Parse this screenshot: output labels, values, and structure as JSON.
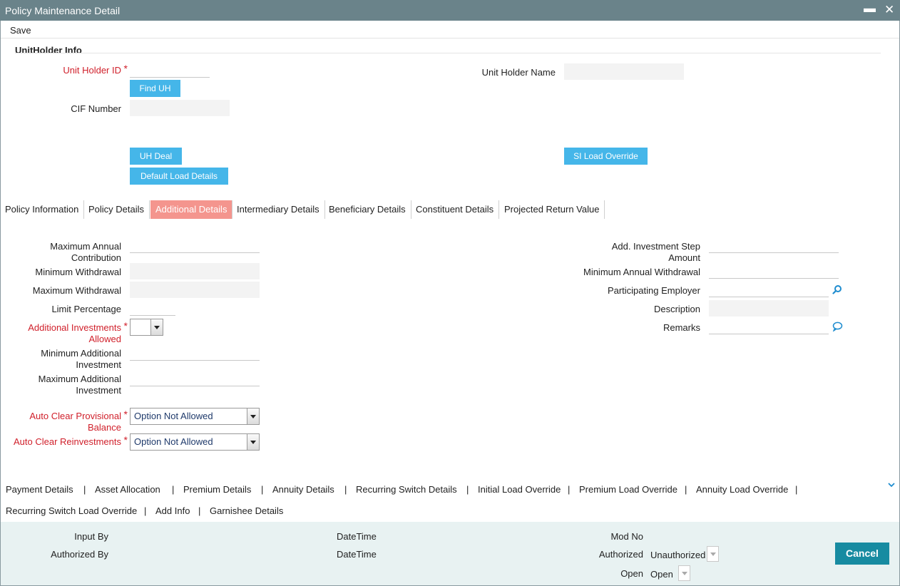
{
  "window": {
    "title": "Policy Maintenance Detail",
    "minimize_glyph": "▬",
    "close_glyph": "✕"
  },
  "toolbar": {
    "save_label": "Save"
  },
  "unitholder": {
    "section_title": "UnitHolder Info",
    "unit_holder_id_label": "Unit Holder ID",
    "unit_holder_id_value": "",
    "find_uh_button": "Find UH",
    "unit_holder_name_label": "Unit Holder Name",
    "unit_holder_name_value": "",
    "cif_number_label": "CIF Number",
    "cif_number_value": "",
    "uh_deal_button": "UH Deal",
    "default_load_details_button": "Default Load Details",
    "si_load_override_button": "SI Load Override"
  },
  "tabs": [
    {
      "label": "Policy Information",
      "active": false
    },
    {
      "label": "Policy Details",
      "active": false
    },
    {
      "label": "Additional Details",
      "active": true
    },
    {
      "label": "Intermediary Details",
      "active": false
    },
    {
      "label": "Beneficiary Details",
      "active": false
    },
    {
      "label": "Constituent Details",
      "active": false
    },
    {
      "label": "Projected Return Value",
      "active": false
    }
  ],
  "additional": {
    "max_annual_contribution_label_1": "Maximum Annual",
    "max_annual_contribution_label_2": "Contribution",
    "min_withdrawal_label": "Minimum Withdrawal",
    "max_withdrawal_label": "Maximum Withdrawal",
    "limit_percentage_label": "Limit Percentage",
    "additional_investments_allowed_label_1": "Additional Investments",
    "additional_investments_allowed_label_2": "Allowed",
    "min_additional_investment_label_1": "Minimum Additional",
    "min_additional_investment_label_2": "Investment",
    "max_additional_investment_label_1": "Maximum Additional",
    "max_additional_investment_label_2": "Investment",
    "auto_clear_provisional_balance_label_1": "Auto Clear Provisional",
    "auto_clear_provisional_balance_label_2": "Balance",
    "auto_clear_provisional_balance_value": "Option Not Allowed",
    "auto_clear_reinvestments_label": "Auto Clear Reinvestments",
    "auto_clear_reinvestments_value": "Option Not Allowed",
    "add_investment_step_amount_label_1": "Add. Investment Step",
    "add_investment_step_amount_label_2": "Amount",
    "min_annual_withdrawal_label": "Minimum Annual Withdrawal",
    "participating_employer_label": "Participating Employer",
    "description_label": "Description",
    "remarks_label": "Remarks"
  },
  "bottom_links": {
    "row1": [
      "Payment Details",
      "Asset Allocation",
      "Premium Details",
      "Annuity Details",
      "Recurring Switch Details",
      "Initial Load Override",
      "Premium Load Override",
      "Annuity Load Override"
    ],
    "row2": [
      "Recurring Switch Load Override",
      "Add Info",
      "Garnishee Details"
    ],
    "separator": "|"
  },
  "footer": {
    "input_by_label": "Input By",
    "datetime_label_1": "DateTime",
    "mod_no_label": "Mod No",
    "authorized_by_label": "Authorized By",
    "datetime_label_2": "DateTime",
    "authorized_label": "Authorized",
    "authorized_value": "Unauthorized",
    "open_label": "Open",
    "open_value": "Open",
    "cancel_button": "Cancel"
  },
  "colors": {
    "titlebar": "#6a838a",
    "button_blue": "#45b6e9",
    "active_tab": "#f4958e",
    "required_red": "#d01f2a",
    "cancel_teal": "#178ba1",
    "footer_bg": "#e8f2f2"
  }
}
